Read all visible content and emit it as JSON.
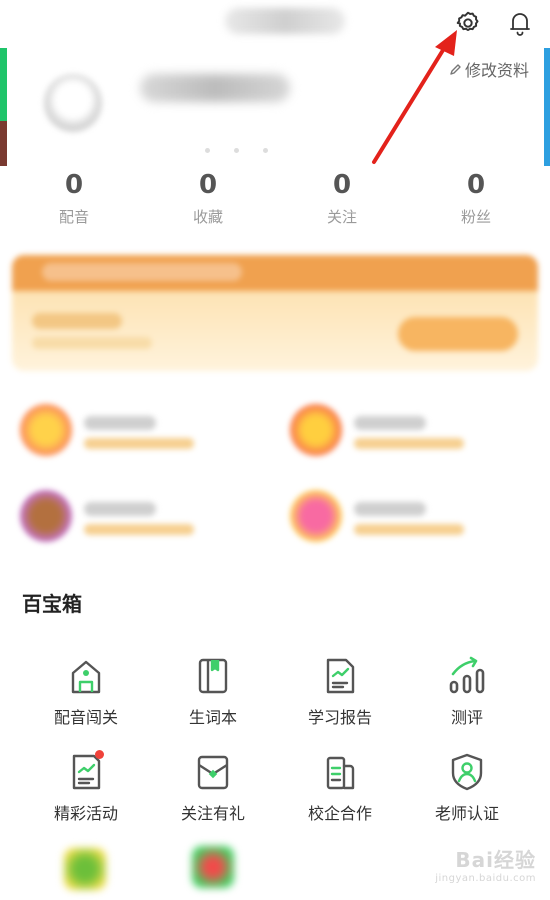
{
  "header": {
    "edit_profile_label": "修改资料",
    "icons": {
      "settings": "gear-icon",
      "notifications": "bell-icon",
      "edit": "pencil-icon"
    }
  },
  "stats": [
    {
      "value": "0",
      "label": "配音"
    },
    {
      "value": "0",
      "label": "收藏"
    },
    {
      "value": "0",
      "label": "关注"
    },
    {
      "value": "0",
      "label": "粉丝"
    }
  ],
  "toolbox": {
    "title": "百宝箱",
    "items": [
      {
        "label": "配音闯关",
        "icon": "house-icon"
      },
      {
        "label": "生词本",
        "icon": "notebook-icon"
      },
      {
        "label": "学习报告",
        "icon": "report-icon"
      },
      {
        "label": "测评",
        "icon": "assessment-chart-icon"
      },
      {
        "label": "精彩活动",
        "icon": "activity-icon",
        "badge_dot": true
      },
      {
        "label": "关注有礼",
        "icon": "gift-envelope-icon"
      },
      {
        "label": "校企合作",
        "icon": "cooperation-icon"
      },
      {
        "label": "老师认证",
        "icon": "teacher-shield-icon"
      }
    ]
  },
  "colors": {
    "accent_green": "#3ecf6a",
    "icon_gray": "#555555",
    "annotation_arrow": "#e3221b",
    "badge_red": "#f0423a",
    "promo_orange": "#f0a14f"
  },
  "watermark": {
    "line1": "Bai经验",
    "line2": "jingyan.baidu.com"
  }
}
